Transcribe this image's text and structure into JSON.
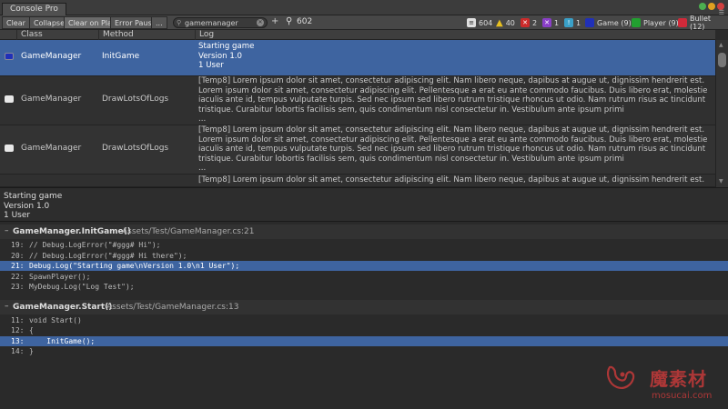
{
  "window": {
    "tab_title": "Console Pro"
  },
  "toolbar": {
    "buttons": [
      {
        "label": "Clear",
        "active": false
      },
      {
        "label": "Collapse",
        "active": false
      },
      {
        "label": "Clear on Play",
        "active": true
      },
      {
        "label": "Error Pause",
        "active": false
      },
      {
        "label": "...",
        "active": false
      }
    ],
    "search": {
      "value": "gamemanager",
      "placeholder": ""
    },
    "add_label": "+",
    "match_count": "602",
    "filters": [
      {
        "icon": "log-icon",
        "count": "604",
        "color": "#e0e0e0",
        "glyph": "≡"
      },
      {
        "icon": "warning-icon",
        "count": "40",
        "color": "#e8c020",
        "glyph": "!"
      },
      {
        "icon": "error-icon",
        "count": "2",
        "color": "#cc2b2b",
        "glyph": "✕"
      },
      {
        "icon": "custom-purple-icon",
        "count": "1",
        "color": "#8a3fc8",
        "glyph": "✕"
      },
      {
        "icon": "custom-cyan-icon",
        "count": "1",
        "color": "#3aa0c8",
        "glyph": "!"
      },
      {
        "icon": "game-icon",
        "count": "Game (9)",
        "color": "#2030b8",
        "glyph": ""
      },
      {
        "icon": "player-icon",
        "count": "Player (9)",
        "color": "#22a030",
        "glyph": ""
      },
      {
        "icon": "bullet-icon",
        "count": "Bullet (12)",
        "color": "#d02a3a",
        "glyph": ""
      }
    ]
  },
  "table": {
    "columns": [
      "Class",
      "Method",
      "Log"
    ],
    "rows": [
      {
        "icon": "game-icon",
        "class": "GameManager",
        "method": "InitGame",
        "log": "Starting game\nVersion 1.0\n1 User"
      },
      {
        "icon": "chat-icon",
        "class": "GameManager",
        "method": "DrawLotsOfLogs",
        "log": "[Temp8] Lorem ipsum dolor sit amet, consectetur adipiscing elit. Nam libero neque, dapibus at augue ut, dignissim hendrerit est.\nLorem ipsum dolor sit amet, consectetur adipiscing elit. Pellentesque a erat eu ante commodo faucibus. Duis libero erat, molestie\niaculis ante id, tempus vulputate turpis. Sed nec ipsum sed libero rutrum tristique rhoncus ut odio. Nam rutrum risus ac tincidunt\ntristique. Curabitur lobortis facilisis sem, quis condimentum nisl consectetur in. Vestibulum ante ipsum primi\n..."
      },
      {
        "icon": "chat-icon",
        "class": "GameManager",
        "method": "DrawLotsOfLogs",
        "log": "[Temp8] Lorem ipsum dolor sit amet, consectetur adipiscing elit. Nam libero neque, dapibus at augue ut, dignissim hendrerit est.\nLorem ipsum dolor sit amet, consectetur adipiscing elit. Pellentesque a erat eu ante commodo faucibus. Duis libero erat, molestie\niaculis ante id, tempus vulputate turpis. Sed nec ipsum sed libero rutrum tristique rhoncus ut odio. Nam rutrum risus ac tincidunt\ntristique. Curabitur lobortis facilisis sem, quis condimentum nisl consectetur in. Vestibulum ante ipsum primi\n..."
      },
      {
        "icon": "",
        "class": "",
        "method": "",
        "log": "[Temp8] Lorem ipsum dolor sit amet, consectetur adipiscing elit. Nam libero neque, dapibus at augue ut, dignissim hendrerit est."
      }
    ]
  },
  "detail": {
    "text": "Starting game\nVersion 1.0\n1 User"
  },
  "stack": [
    {
      "function": "GameManager.InitGame()",
      "path": "Assets/Test/GameManager.cs:21",
      "lines": [
        {
          "num": "19:",
          "code": "// Debug.LogError(\"#ggg# Hi\");",
          "highlight": false
        },
        {
          "num": "20:",
          "code": "// Debug.LogError(\"#ggg# Hi there\");",
          "highlight": false
        },
        {
          "num": "21:",
          "code": "Debug.Log(\"Starting game\\nVersion 1.0\\n1 User\");",
          "highlight": true
        },
        {
          "num": "22:",
          "code": "SpawnPlayer();",
          "highlight": false
        },
        {
          "num": "23:",
          "code": "MyDebug.Log(\"Log Test\");",
          "highlight": false
        }
      ]
    },
    {
      "function": "GameManager.Start()",
      "path": "Assets/Test/GameManager.cs:13",
      "lines": [
        {
          "num": "11:",
          "code": "void Start()",
          "highlight": false
        },
        {
          "num": "12:",
          "code": "{",
          "highlight": false
        },
        {
          "num": "13:",
          "code": "    InitGame();",
          "highlight": true
        },
        {
          "num": "14:",
          "code": "}",
          "highlight": false
        }
      ]
    }
  ],
  "watermark": {
    "brand": "魔素材",
    "url": "mosucai.com"
  }
}
